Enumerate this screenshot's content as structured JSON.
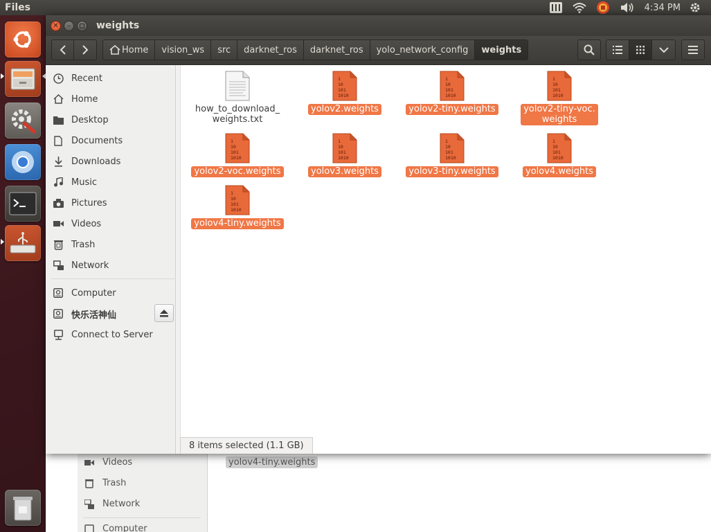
{
  "top_panel": {
    "app_title": "Files",
    "clock": "4:34 PM",
    "icons": [
      "keyboard-indicator-icon",
      "wifi-icon",
      "input-method-icon",
      "volume-icon",
      "power-gear-icon"
    ]
  },
  "launcher": {
    "items": [
      "ubuntu-dash",
      "files",
      "system-settings",
      "chromium",
      "terminal",
      "usb-creator",
      "trash"
    ]
  },
  "window": {
    "title": "weights"
  },
  "toolbar": {
    "breadcrumbs": [
      "Home",
      "vision_ws",
      "src",
      "darknet_ros",
      "darknet_ros",
      "yolo_network_config",
      "weights"
    ]
  },
  "sidebar": {
    "items": [
      "Recent",
      "Home",
      "Desktop",
      "Documents",
      "Downloads",
      "Music",
      "Pictures",
      "Videos",
      "Trash",
      "Network"
    ],
    "devices": [
      "Computer",
      "快乐活神仙"
    ],
    "connect": "Connect to Server"
  },
  "files": [
    {
      "name": "how_to_download_\nweights.txt",
      "type": "text",
      "selected": false
    },
    {
      "name": "yolov2.weights",
      "type": "binary",
      "selected": true
    },
    {
      "name": "yolov2-tiny.weights",
      "type": "binary",
      "selected": true
    },
    {
      "name": "yolov2-tiny-voc.\nweights",
      "type": "binary",
      "selected": true
    },
    {
      "name": "yolov2-voc.weights",
      "type": "binary",
      "selected": true
    },
    {
      "name": "yolov3.weights",
      "type": "binary",
      "selected": true
    },
    {
      "name": "yolov3-tiny.weights",
      "type": "binary",
      "selected": true
    },
    {
      "name": "yolov4.weights",
      "type": "binary",
      "selected": true
    },
    {
      "name": "yolov4-tiny.weights",
      "type": "binary",
      "selected": true
    }
  ],
  "binary_icon_text": [
    "1",
    "10",
    "101",
    "1010"
  ],
  "status": "8 items selected (1.1 GB)",
  "background_window": {
    "sidebar_items": [
      "Videos",
      "Trash",
      "Network",
      "Computer"
    ],
    "file_label": "yolov4-tiny.weights"
  },
  "colors": {
    "accent": "#f07746",
    "panel": "#3c3b37",
    "close_button": "#e05a2f"
  }
}
